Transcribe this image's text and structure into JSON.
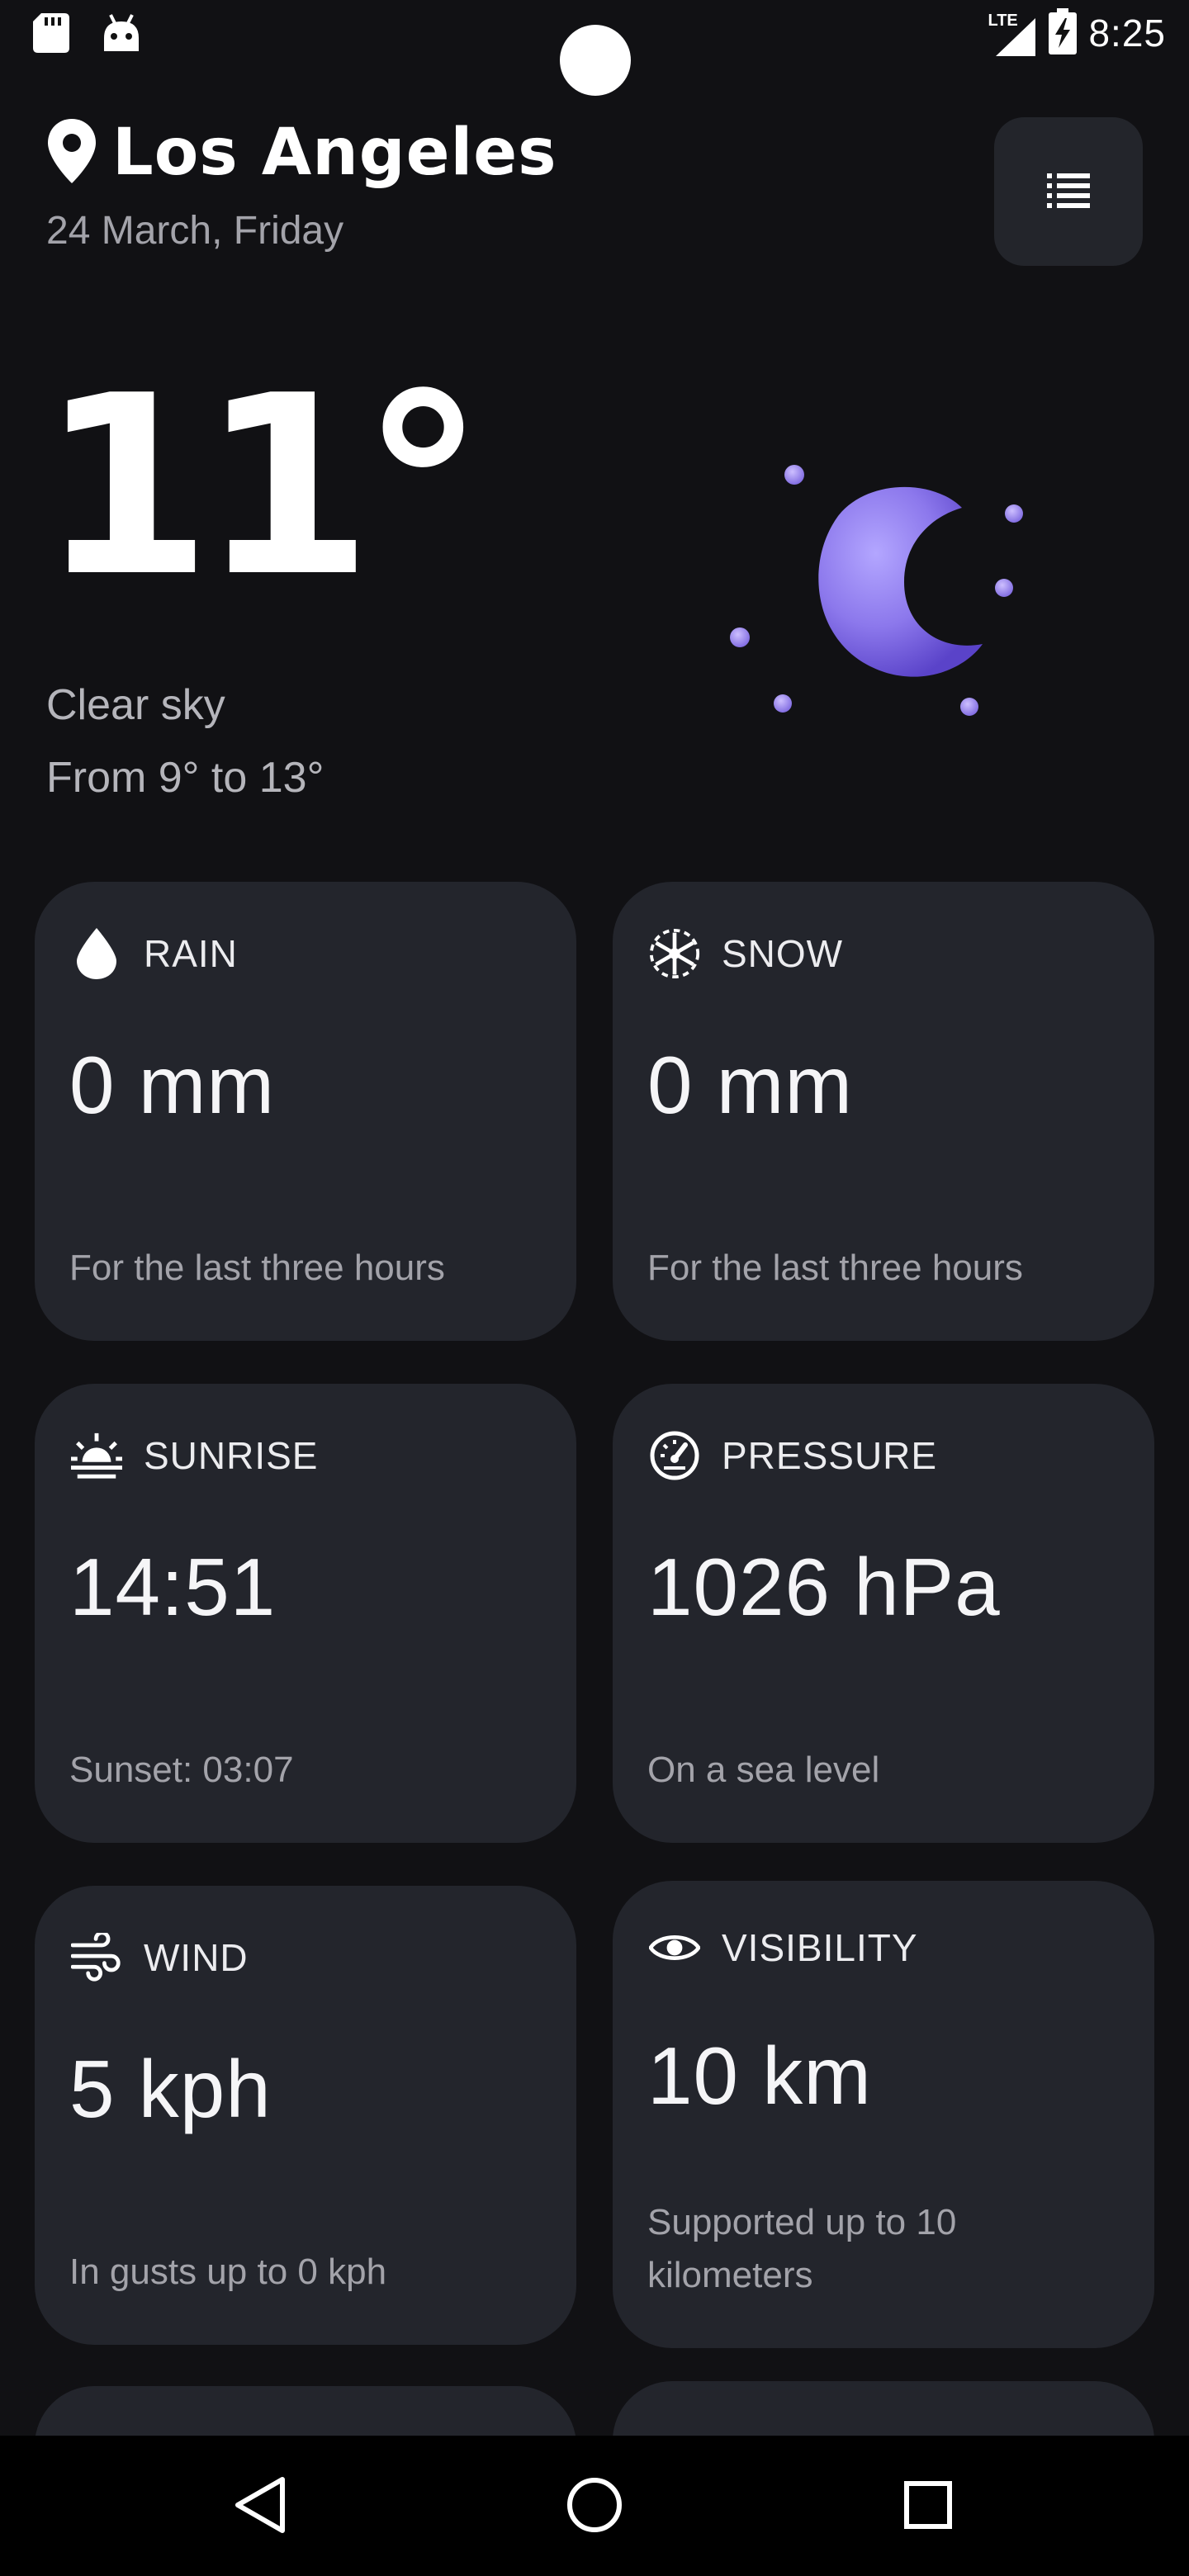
{
  "status_bar": {
    "time": "8:25",
    "network": "LTE",
    "icons": [
      "sd-card-icon",
      "android-icon",
      "lte-signal-icon",
      "battery-charging-icon"
    ]
  },
  "header": {
    "city": "Los Angeles",
    "date": "24 March, Friday",
    "menu_icon": "list-icon"
  },
  "current": {
    "temperature": "11°",
    "condition": "Clear sky",
    "range": "From 9° to 13°",
    "illustration": "moon-icon"
  },
  "cards": [
    {
      "title": "RAIN",
      "value": "0 mm",
      "note": "For the last three hours",
      "icon": "droplet-icon"
    },
    {
      "title": "SNOW",
      "value": "0 mm",
      "note": "For the last three hours",
      "icon": "snowflake-icon"
    },
    {
      "title": "SUNRISE",
      "value": "14:51",
      "note": "Sunset: 03:07",
      "icon": "sunrise-icon"
    },
    {
      "title": "PRESSURE",
      "value": "1026 hPa",
      "note": "On a sea level",
      "icon": "gauge-icon"
    },
    {
      "title": "WIND",
      "value": "5 kph",
      "note": "In gusts up to 0 kph",
      "icon": "wind-icon"
    },
    {
      "title": "VISIBILITY",
      "value": "10 km",
      "note": "Supported up to 10 kilometers",
      "icon": "eye-icon"
    }
  ],
  "colors": {
    "background": "#111114",
    "card": "#23252c",
    "accent_moon": "#8d7be8",
    "muted_text": "#a3a3aa"
  },
  "nav_bar": {
    "items": [
      "back-icon",
      "home-icon",
      "recents-icon"
    ]
  }
}
